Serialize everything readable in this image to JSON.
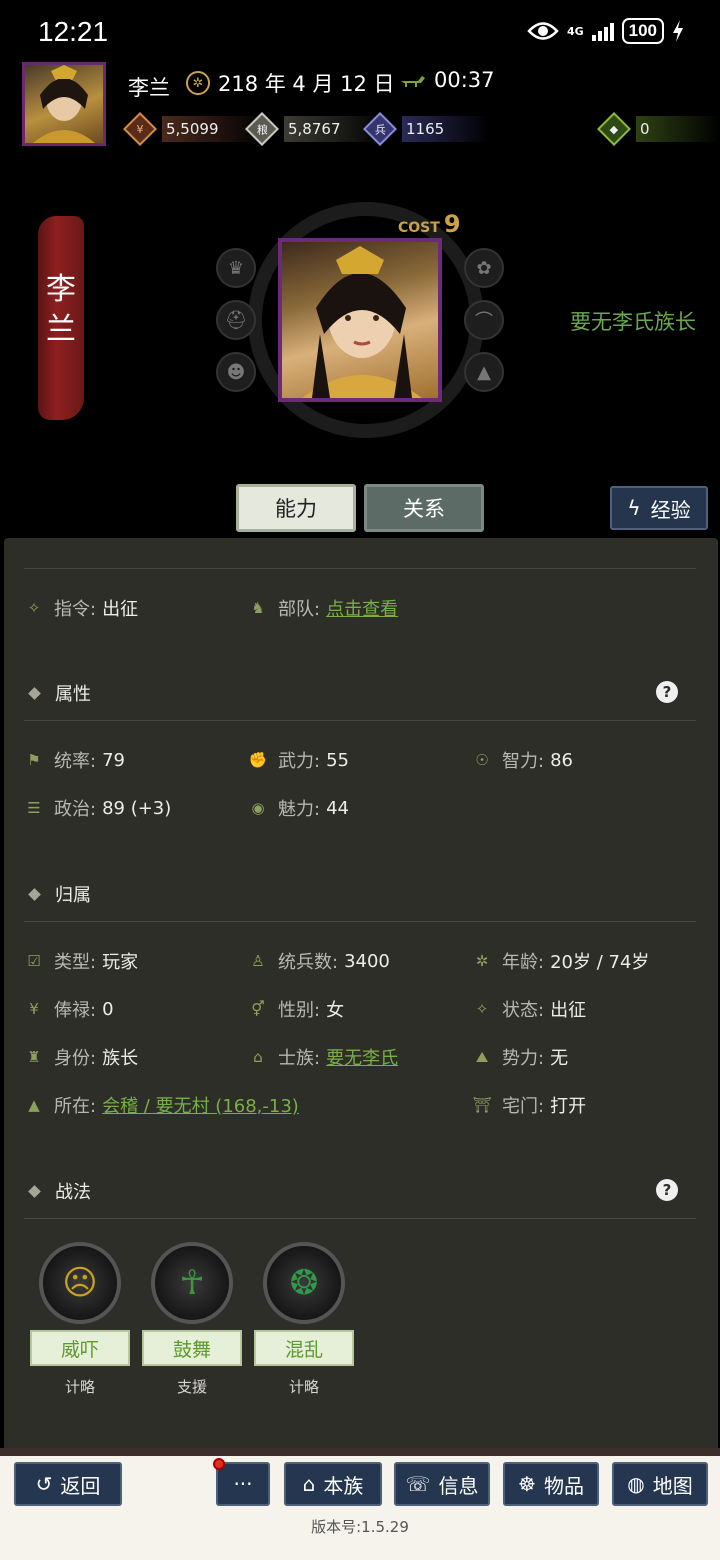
{
  "status_bar": {
    "time": "12:21",
    "network": "4G",
    "battery": "100"
  },
  "header": {
    "name": "李兰",
    "date": "218 年 4 月 12 日",
    "clock": "00:37",
    "resources": [
      {
        "icon": "money-icon",
        "value": "5,5099"
      },
      {
        "icon": "grain-icon",
        "value": "5,8767"
      },
      {
        "icon": "troops-icon",
        "value": "1165"
      },
      {
        "icon": "jade-icon",
        "value": "0"
      }
    ]
  },
  "character": {
    "banner_name": "李兰",
    "cost_label": "COST",
    "cost_value": "9",
    "clan_title": "要无李氏族长"
  },
  "tabs": {
    "ability": "能力",
    "relation": "关系",
    "exp": "经验"
  },
  "command": {
    "order_label": "指令:",
    "order_value": "出征",
    "unit_label": "部队:",
    "unit_value": "点击查看"
  },
  "attributes": {
    "title": "属性",
    "items": [
      {
        "label": "统率:",
        "value": "79"
      },
      {
        "label": "武力:",
        "value": "55"
      },
      {
        "label": "智力:",
        "value": "86"
      },
      {
        "label": "政治:",
        "value": "89 (+3)"
      },
      {
        "label": "魅力:",
        "value": "44"
      }
    ]
  },
  "belonging": {
    "title": "归属",
    "items": [
      {
        "label": "类型:",
        "value": "玩家"
      },
      {
        "label": "统兵数:",
        "value": "3400"
      },
      {
        "label": "年龄:",
        "value": "20岁 / 74岁"
      },
      {
        "label": "俸禄:",
        "value": "0"
      },
      {
        "label": "性别:",
        "value": "女"
      },
      {
        "label": "状态:",
        "value": "出征"
      },
      {
        "label": "身份:",
        "value": "族长"
      },
      {
        "label": "士族:",
        "value": "要无李氏"
      },
      {
        "label": "势力:",
        "value": "无"
      },
      {
        "label": "所在:",
        "value": "会稽 / 要无村 (168,-13)"
      },
      {
        "label": "宅门:",
        "value": "打开"
      }
    ]
  },
  "tactics": {
    "title": "战法",
    "items": [
      {
        "name": "威吓",
        "type": "计略",
        "color": "#c9a21e"
      },
      {
        "name": "鼓舞",
        "type": "支援",
        "color": "#3c9a3c"
      },
      {
        "name": "混乱",
        "type": "计略",
        "color": "#2f9a4a"
      }
    ]
  },
  "bottom_nav": {
    "back": "返回",
    "more": "···",
    "clan": "本族",
    "info": "信息",
    "items": "物品",
    "map": "地图",
    "version": "版本号:1.5.29"
  },
  "colors": {
    "accent_green": "#78b048",
    "panel_bg": "#2d2e27",
    "nav_button": "#243650"
  }
}
